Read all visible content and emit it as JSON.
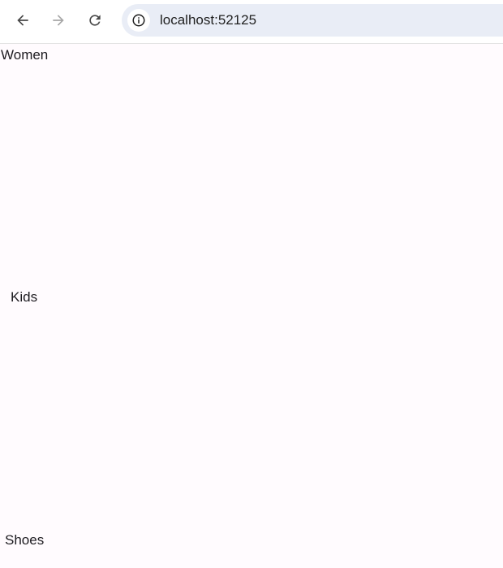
{
  "browser": {
    "url": "localhost:52125",
    "icons": {
      "back": "arrow-left-icon",
      "forward": "arrow-right-icon",
      "reload": "reload-icon",
      "site_info": "info-icon"
    }
  },
  "categories": [
    {
      "label": "Women"
    },
    {
      "label": "Kids"
    },
    {
      "label": "Shoes"
    }
  ]
}
